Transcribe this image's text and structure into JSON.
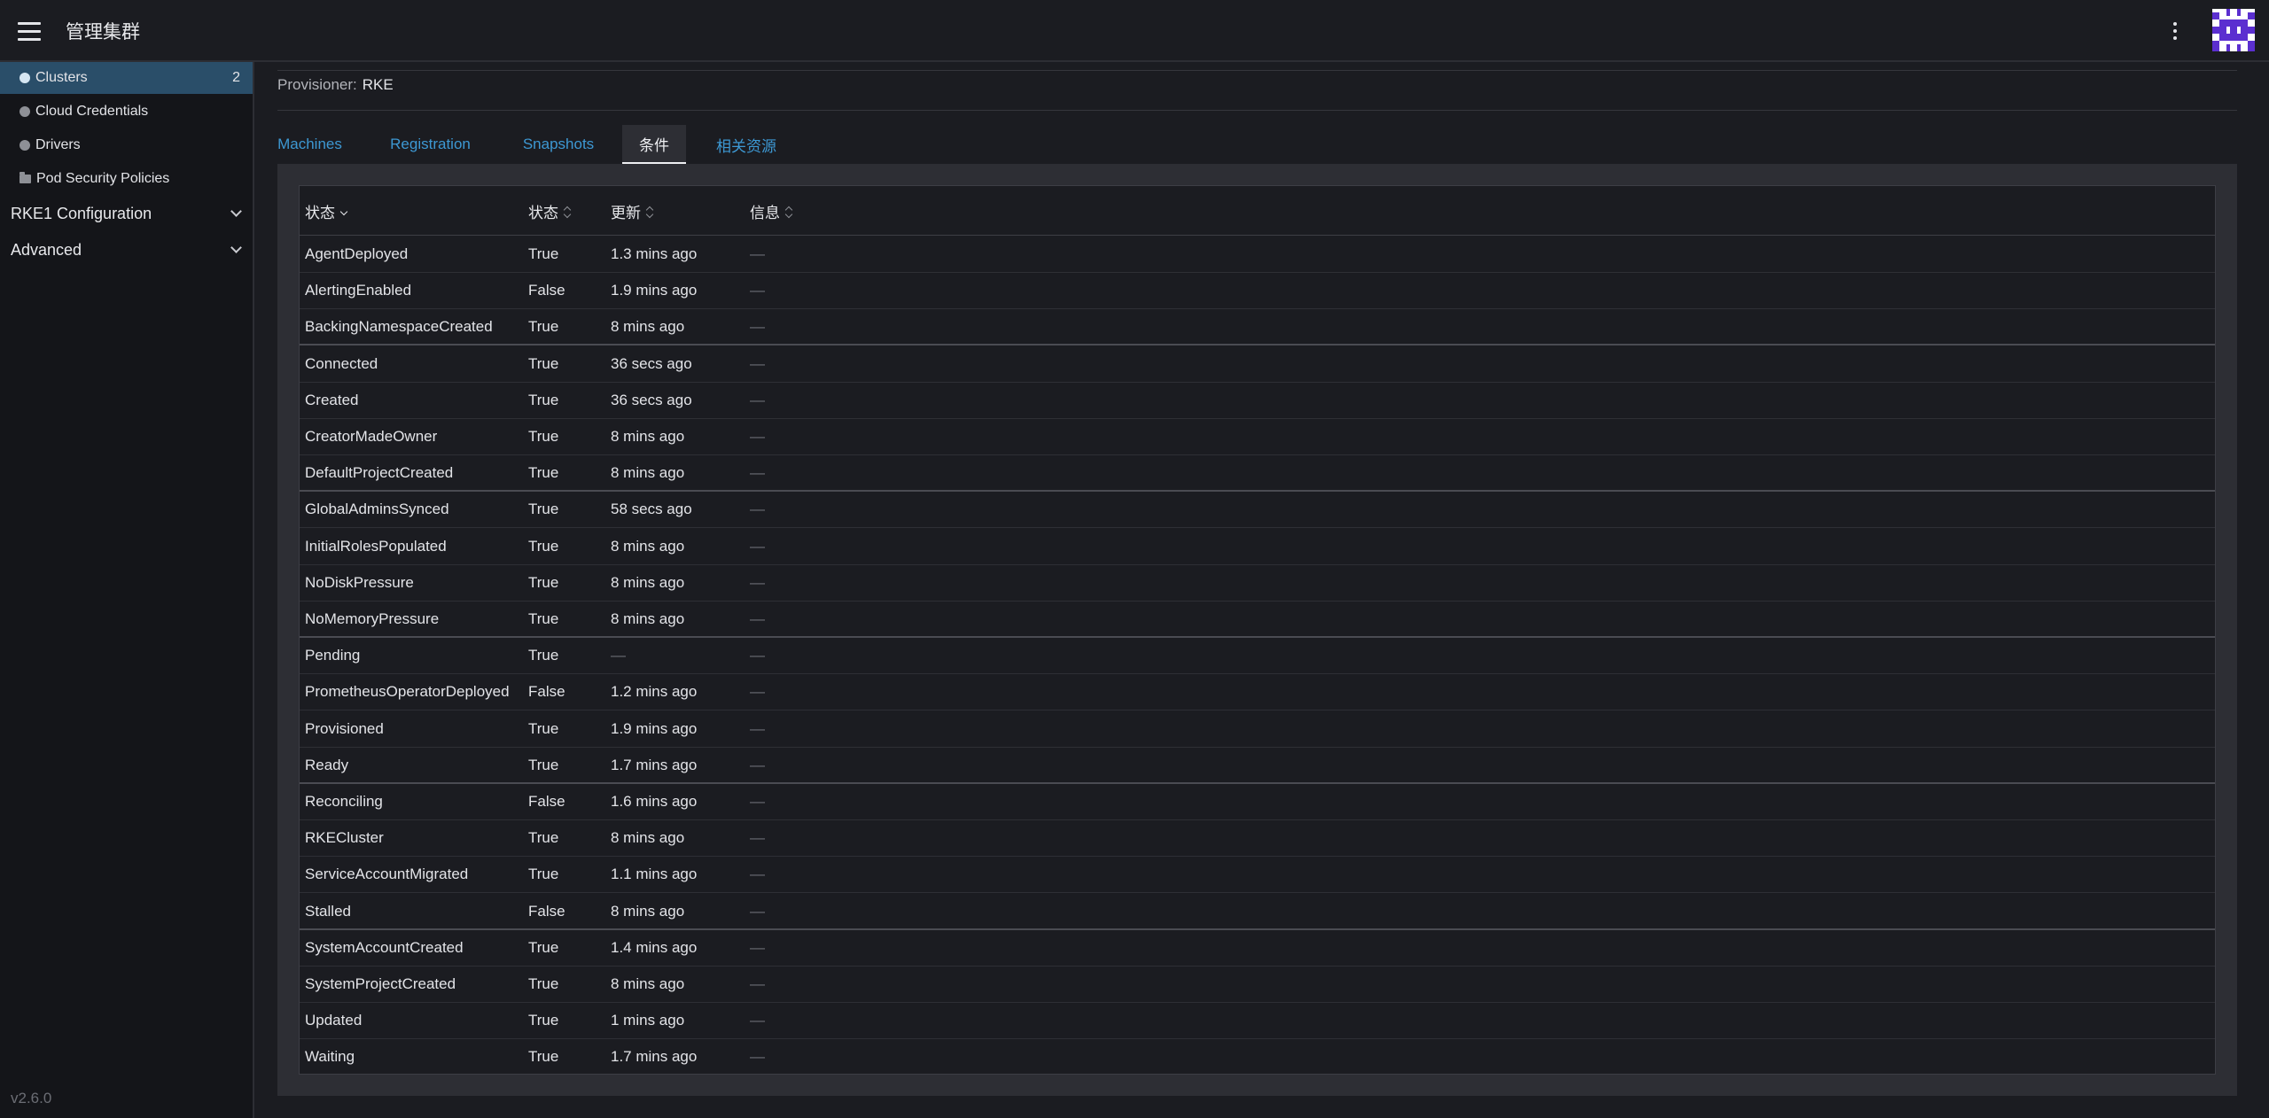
{
  "header": {
    "title": "管理集群"
  },
  "sidebar": {
    "items": [
      {
        "label": "Clusters",
        "badge": "2",
        "icon": "circle-icon",
        "active": true
      },
      {
        "label": "Cloud Credentials",
        "icon": "circle-icon"
      },
      {
        "label": "Drivers",
        "icon": "circle-icon"
      },
      {
        "label": "Pod Security Policies",
        "icon": "folder-icon"
      }
    ],
    "groups": [
      {
        "label": "RKE1 Configuration"
      },
      {
        "label": "Advanced"
      }
    ],
    "version": "v2.6.0"
  },
  "provisioner": {
    "label": "Provisioner:",
    "value": "RKE"
  },
  "tabs": [
    {
      "label": "Machines"
    },
    {
      "label": "Registration"
    },
    {
      "label": "Snapshots"
    },
    {
      "label": "条件",
      "active": true
    },
    {
      "label": "相关资源"
    }
  ],
  "table": {
    "headers": [
      "状态",
      "状态",
      "更新",
      "信息"
    ],
    "rows": [
      [
        "AgentDeployed",
        "True",
        "1.3 mins ago",
        "—"
      ],
      [
        "AlertingEnabled",
        "False",
        "1.9 mins ago",
        "—"
      ],
      [
        "BackingNamespaceCreated",
        "True",
        "8 mins ago",
        "—"
      ],
      [
        "Connected",
        "True",
        "36 secs ago",
        "—"
      ],
      [
        "Created",
        "True",
        "36 secs ago",
        "—"
      ],
      [
        "CreatorMadeOwner",
        "True",
        "8 mins ago",
        "—"
      ],
      [
        "DefaultProjectCreated",
        "True",
        "8 mins ago",
        "—"
      ],
      [
        "GlobalAdminsSynced",
        "True",
        "58 secs ago",
        "—"
      ],
      [
        "InitialRolesPopulated",
        "True",
        "8 mins ago",
        "—"
      ],
      [
        "NoDiskPressure",
        "True",
        "8 mins ago",
        "—"
      ],
      [
        "NoMemoryPressure",
        "True",
        "8 mins ago",
        "—"
      ],
      [
        "Pending",
        "True",
        "—",
        "—"
      ],
      [
        "PrometheusOperatorDeployed",
        "False",
        "1.2 mins ago",
        "—"
      ],
      [
        "Provisioned",
        "True",
        "1.9 mins ago",
        "—"
      ],
      [
        "Ready",
        "True",
        "1.7 mins ago",
        "—"
      ],
      [
        "Reconciling",
        "False",
        "1.6 mins ago",
        "—"
      ],
      [
        "RKECluster",
        "True",
        "8 mins ago",
        "—"
      ],
      [
        "ServiceAccountMigrated",
        "True",
        "1.1 mins ago",
        "—"
      ],
      [
        "Stalled",
        "False",
        "8 mins ago",
        "—"
      ],
      [
        "SystemAccountCreated",
        "True",
        "1.4 mins ago",
        "—"
      ],
      [
        "SystemProjectCreated",
        "True",
        "8 mins ago",
        "—"
      ],
      [
        "Updated",
        "True",
        "1 mins ago",
        "—"
      ],
      [
        "Waiting",
        "True",
        "1.7 mins ago",
        "—"
      ]
    ]
  }
}
